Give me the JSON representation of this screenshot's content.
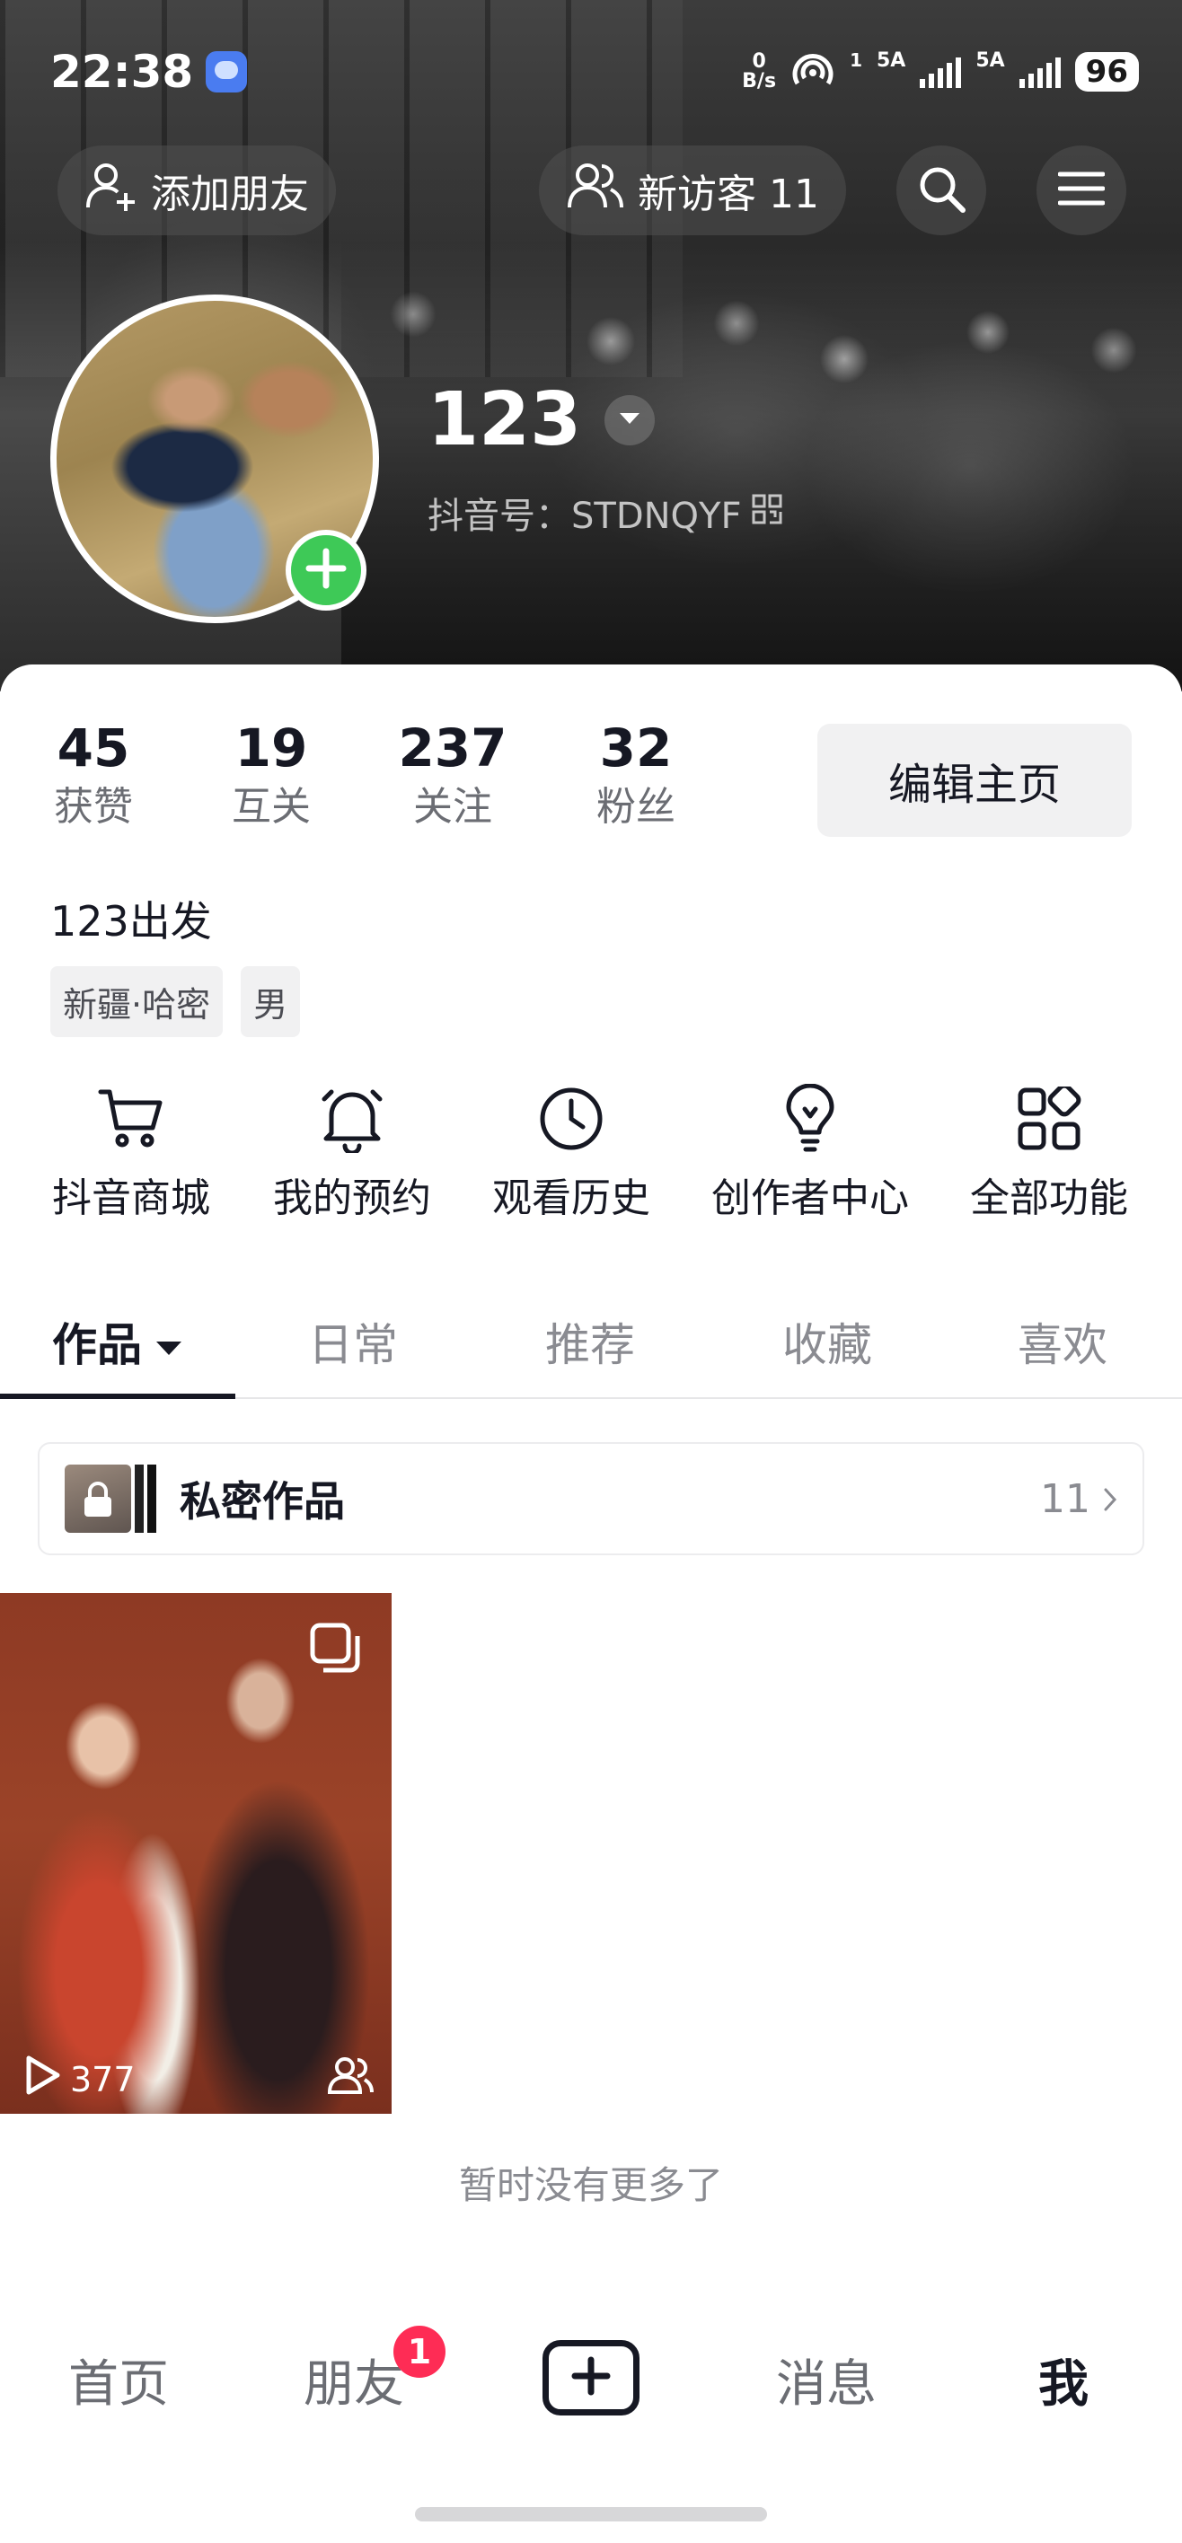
{
  "status_bar": {
    "time": "22:38",
    "net_speed_top": "0",
    "net_speed_unit": "B/s",
    "hotspot_count": "1",
    "sim1_label": "5A",
    "sim2_label": "5A",
    "battery": "96"
  },
  "top_bar": {
    "add_friend_label": "添加朋友",
    "visitors_label": "新访客 11"
  },
  "profile": {
    "username": "123",
    "douyin_id": "抖音号：STDNQYF",
    "bio": "123出发",
    "tags": [
      "新疆·哈密",
      "男"
    ],
    "stats": [
      {
        "value": "45",
        "label": "获赞"
      },
      {
        "value": "19",
        "label": "互关"
      },
      {
        "value": "237",
        "label": "关注"
      },
      {
        "value": "32",
        "label": "粉丝"
      }
    ],
    "edit_button": "编辑主页"
  },
  "features": [
    {
      "label": "抖音商城",
      "icon": "cart-icon"
    },
    {
      "label": "我的预约",
      "icon": "bell-icon"
    },
    {
      "label": "观看历史",
      "icon": "clock-icon"
    },
    {
      "label": "创作者中心",
      "icon": "lightbulb-icon"
    },
    {
      "label": "全部功能",
      "icon": "grid-icon"
    }
  ],
  "tabs": [
    {
      "label": "作品",
      "active": true
    },
    {
      "label": "日常",
      "active": false
    },
    {
      "label": "推荐",
      "active": false
    },
    {
      "label": "收藏",
      "active": false
    },
    {
      "label": "喜欢",
      "active": false
    }
  ],
  "private_works": {
    "label": "私密作品",
    "count": "11"
  },
  "videos": [
    {
      "plays": "377"
    }
  ],
  "no_more_text": "暂时没有更多了",
  "bottom_nav": {
    "home": "首页",
    "friends": "朋友",
    "friends_badge": "1",
    "messages": "消息",
    "me": "我"
  },
  "colors": {
    "accent_green": "#3ec957",
    "badge_red": "#fe2c55",
    "text_primary": "#161823",
    "text_secondary": "#8a8b91"
  }
}
